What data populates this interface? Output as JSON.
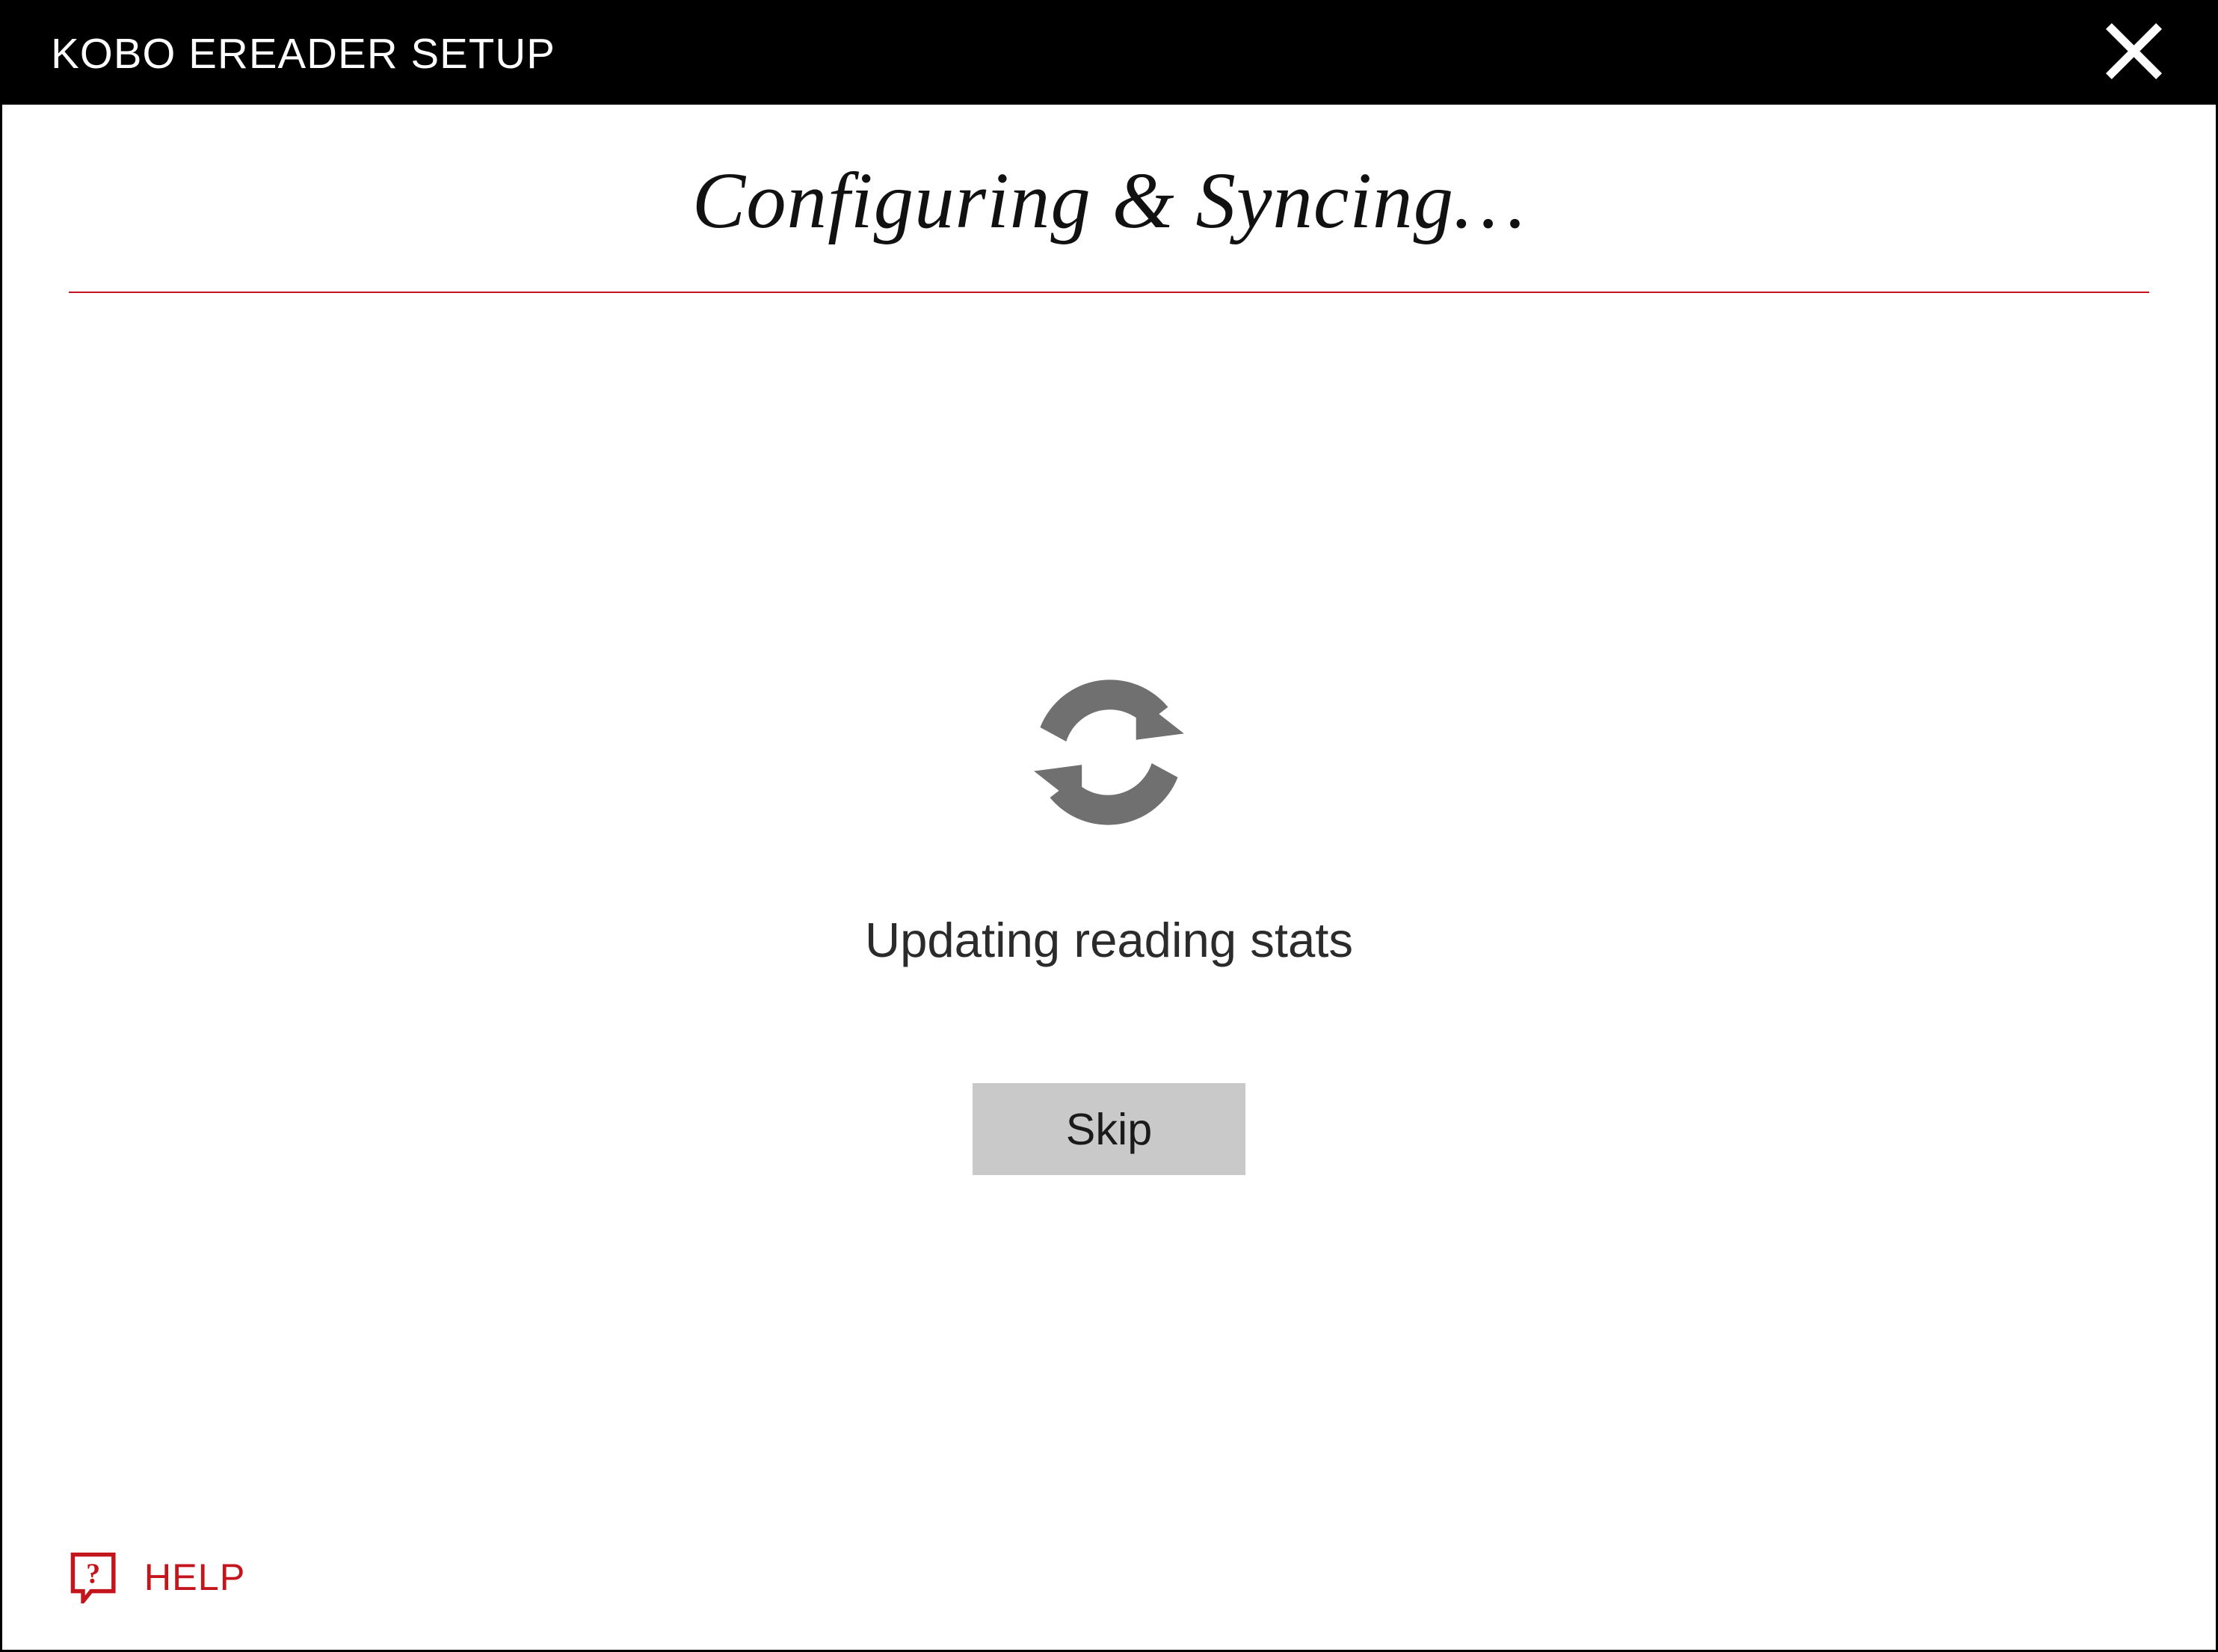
{
  "titlebar": {
    "title": "KOBO EREADER SETUP"
  },
  "main": {
    "heading": "Configuring & Syncing…",
    "status": "Updating reading stats",
    "skip_label": "Skip"
  },
  "footer": {
    "help_label": "HELP"
  },
  "icons": {
    "close": "close-icon",
    "sync": "sync-arrows-icon",
    "help": "help-bubble-icon"
  },
  "colors": {
    "accent": "#c4151c",
    "titlebar_bg": "#000000",
    "titlebar_fg": "#ffffff",
    "button_bg": "#c9c9c9",
    "icon_gray": "#707070"
  }
}
